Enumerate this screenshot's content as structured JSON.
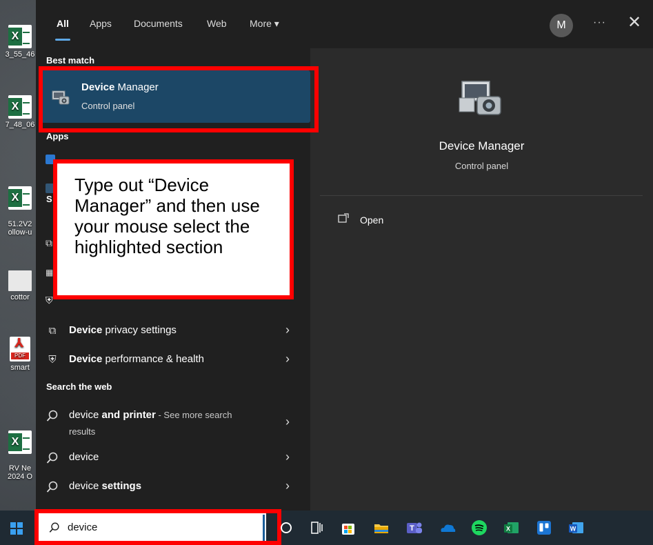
{
  "desktop_icons": [
    {
      "type": "excel",
      "label": "3_55_46",
      "tile": "X"
    },
    {
      "type": "excel",
      "label": "7_48_06",
      "tile": "X"
    },
    {
      "type": "excel",
      "label": "51.2V2\nollow-u",
      "tile": "X"
    },
    {
      "type": "doc",
      "label": "cottor"
    },
    {
      "type": "pdf",
      "label": "smart",
      "tile": "PDF"
    },
    {
      "type": "excel",
      "label": "RV Ne\n2024 O",
      "tile": "X"
    }
  ],
  "search_panel": {
    "tabs": [
      {
        "label": "All",
        "active": true
      },
      {
        "label": "Apps"
      },
      {
        "label": "Documents"
      },
      {
        "label": "Web"
      },
      {
        "label": "More ▾"
      }
    ],
    "avatar_initial": "M",
    "more_options": "···",
    "close": "✕",
    "best_match_heading": "Best match",
    "best_match": {
      "title_bold": "Device",
      "title_rest": " Manager",
      "subtitle": "Control panel",
      "icon": "device-manager-icon"
    },
    "apps_heading": "Apps",
    "settings_heading_fragment": "S",
    "rows": [
      {
        "bold": "Device",
        "rest": " privacy settings",
        "icon": "privacy-icon",
        "chevron": "›"
      },
      {
        "bold": "Device",
        "rest": " performance & health",
        "icon": "shield-icon",
        "chevron": "›"
      }
    ],
    "web_heading": "Search the web",
    "web_rows": [
      {
        "light": "device",
        "bold": " and printer",
        "hint": " - See more search",
        "sub": "results",
        "chevron": "›"
      },
      {
        "light": "device",
        "bold": "",
        "hint": "",
        "sub": "",
        "chevron": "›"
      },
      {
        "light": "device",
        "bold": " settings",
        "hint": "",
        "sub": "",
        "chevron": "›"
      }
    ]
  },
  "preview": {
    "title": "Device Manager",
    "subtitle": "Control panel",
    "open_label": "Open",
    "icon": "device-manager-icon"
  },
  "callout": {
    "text": "Type out “Device Manager” and then use your mouse select the highlighted section"
  },
  "taskbar": {
    "search_value": "device",
    "pinned": [
      "cortana-icon",
      "task-view-icon",
      "store-icon",
      "file-explorer-icon",
      "teams-icon",
      "onedrive-icon",
      "spotify-icon",
      "excel-icon",
      "trello-icon",
      "word-icon"
    ]
  },
  "colors": {
    "highlight_red": "#ff0000",
    "selection_blue": "#1c4766",
    "panel_bg": "#202020",
    "preview_bg": "#2b2b2b",
    "taskbar_bg": "#1f2a33"
  }
}
